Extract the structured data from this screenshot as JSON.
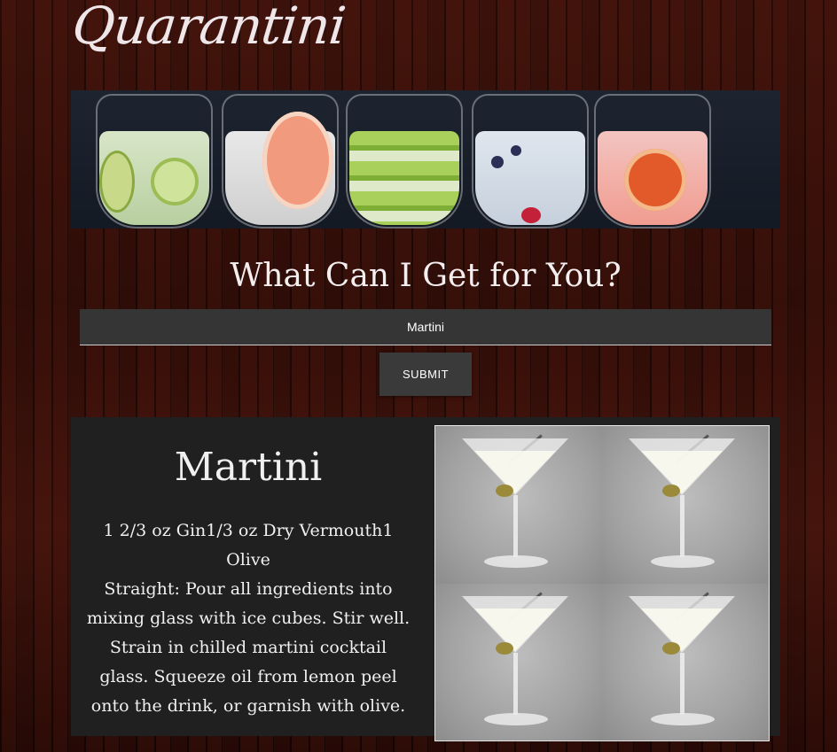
{
  "app": {
    "logo": "Quarantini"
  },
  "search": {
    "heading": "What Can I Get for You?",
    "value": "Martini",
    "submit_label": "SUBMIT"
  },
  "result": {
    "name": "Martini",
    "ingredients": "1 2/3 oz Gin1/3 oz Dry Vermouth1 Olive",
    "instructions": "Straight: Pour all ingredients into mixing glass with ice cubes. Stir well. Strain in chilled martini cocktail glass. Squeeze oil from lemon peel onto the drink, or garnish with olive."
  },
  "colors": {
    "background": "#2a0d08",
    "card": "#202020",
    "input": "#353535",
    "button": "#3a3a3a",
    "text": "#f0f0f0"
  }
}
